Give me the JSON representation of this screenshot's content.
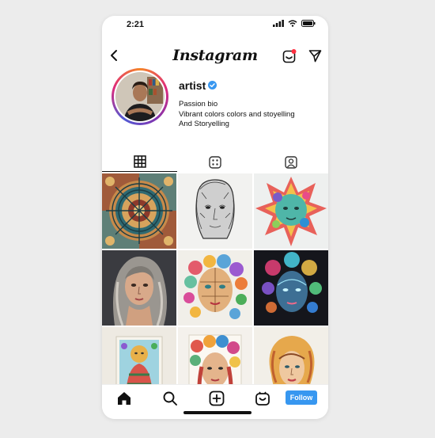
{
  "status_bar": {
    "time": "2:21"
  },
  "header": {
    "app_name": "Instagram"
  },
  "profile": {
    "username": "artist",
    "verified": true,
    "bio_lines": [
      "Passion bio",
      "Vibrant colors colors and stoyelling",
      "And Storyelling"
    ]
  },
  "tabs": [
    {
      "name": "posts",
      "icon": "grid-icon",
      "active": true
    },
    {
      "name": "reels",
      "icon": "reels-icon",
      "active": false
    },
    {
      "name": "tagged",
      "icon": "tagged-icon",
      "active": false
    }
  ],
  "posts": [
    {
      "icon": "mandala-artwork"
    },
    {
      "icon": "pencil-sketch-face"
    },
    {
      "icon": "rainbow-splash-face"
    },
    {
      "icon": "woman-portrait-painting"
    },
    {
      "icon": "floral-face-artwork"
    },
    {
      "icon": "neon-face-dark-artwork"
    },
    {
      "icon": "framed-figure-artwork"
    },
    {
      "icon": "floral-hair-portrait"
    },
    {
      "icon": "woman-face-sketch-colored"
    }
  ],
  "bottom_nav": {
    "items": [
      "home-icon",
      "search-icon",
      "add-post-icon",
      "shop-icon"
    ],
    "follow_label": "Follow"
  },
  "colors": {
    "accent": "#3797f0",
    "verified": "#3897f0"
  }
}
